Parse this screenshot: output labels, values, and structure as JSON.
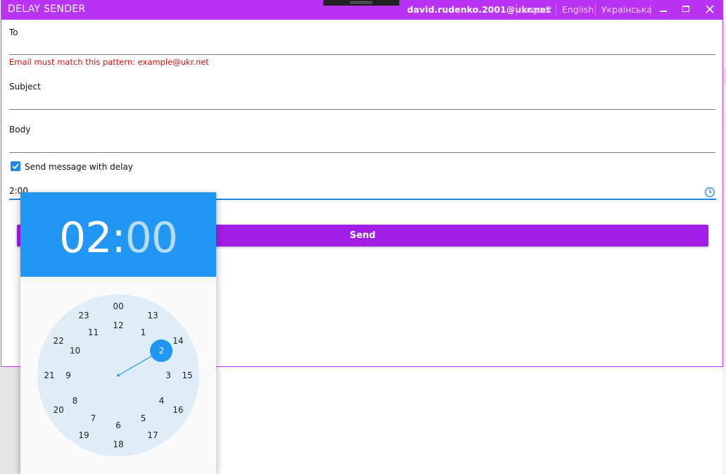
{
  "window": {
    "title": "DELAY SENDER",
    "user_email": "david.rudenko.2001@ukr.net",
    "logout": "Logout",
    "languages": [
      "English",
      "Українська"
    ],
    "minimize_icon": "minimize-icon",
    "maximize_icon": "maximize-icon",
    "close_icon": "close-icon"
  },
  "form": {
    "to_label": "To",
    "to_value": "",
    "to_error": "Email must match this pattern: example@ukr.net",
    "subject_label": "Subject",
    "subject_value": "",
    "body_label": "Body",
    "body_value": "",
    "delay_checkbox_label": "Send message with delay",
    "delay_checked": true,
    "time_value": "2:00",
    "clock_icon": "clock-icon",
    "send_label": "Send"
  },
  "time_picker": {
    "hours": "02",
    "separator": ":",
    "minutes": "00",
    "selected_hour": "2",
    "inner_hours": [
      "12",
      "1",
      "2",
      "3",
      "4",
      "5",
      "6",
      "7",
      "8",
      "9",
      "10",
      "11"
    ],
    "outer_hours": [
      "00",
      "13",
      "14",
      "15",
      "16",
      "17",
      "18",
      "19",
      "20",
      "21",
      "22",
      "23"
    ]
  },
  "colors": {
    "accent_purple": "#b933f2",
    "send_button": "#a21de6",
    "picker_blue": "#2196f3",
    "error_red": "#d41414"
  }
}
